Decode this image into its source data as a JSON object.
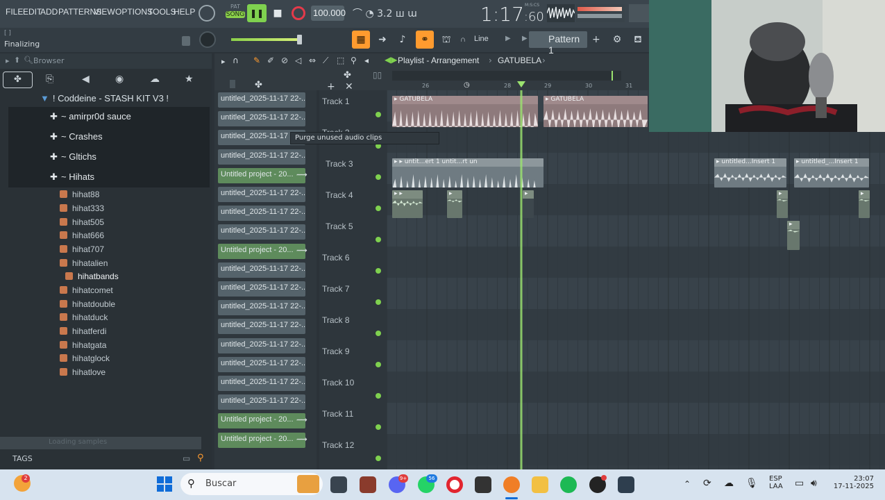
{
  "menu": {
    "items": [
      "FILE",
      "EDIT",
      "ADD",
      "PATTERNS",
      "VIEW",
      "OPTIONS",
      "TOOLS",
      "HELP"
    ]
  },
  "transport": {
    "pat_label": "PAT",
    "song_label": "SONG",
    "tempo": "100.000",
    "time": "1:17",
    "time_sub": ":60",
    "time_unit": "M:S:CS",
    "snap_mode": "Line",
    "pattern": "Pattern 1"
  },
  "hint": {
    "line1": "[ ]",
    "line2": "Finalizing"
  },
  "browser": {
    "title": "Browser",
    "root": "! Coddeine - STASH KIT V3 !",
    "folders": [
      "~ amirpr0d sauce",
      "~ Crashes",
      "~ Gltichs",
      "~ Hihats"
    ],
    "files": [
      "hihat88",
      "hihat333",
      "hihat505",
      "hihat666",
      "hihat707",
      "hihatalien",
      "hihatbands",
      "hihatcomet",
      "hihatdouble",
      "hihatduck",
      "hihatferdi",
      "hihatgata",
      "hihatglock",
      "hihatlove"
    ],
    "status": "Loading samples",
    "tags": "TAGS"
  },
  "playlist": {
    "title": "Playlist - Arrangement",
    "arrangement": "GATUBELA",
    "ruler": [
      "26",
      "28",
      "29",
      "30",
      "31"
    ],
    "tooltip": "Purge unused audio clips"
  },
  "clips": [
    {
      "label": "untitled_2025-11-17 22-...",
      "green": false
    },
    {
      "label": "untitled_2025-11-17 22-...",
      "green": false
    },
    {
      "label": "untitled_2025-11-17 22-...",
      "green": false
    },
    {
      "label": "untitled_2025-11-17 22-...",
      "green": false
    },
    {
      "label": "Untitled project - 20...",
      "green": true
    },
    {
      "label": "untitled_2025-11-17 22-...",
      "green": false
    },
    {
      "label": "untitled_2025-11-17 22-...",
      "green": false
    },
    {
      "label": "untitled_2025-11-17 22-...",
      "green": false
    },
    {
      "label": "Untitled project - 20...",
      "green": true
    },
    {
      "label": "untitled_2025-11-17 22-...",
      "green": false
    },
    {
      "label": "untitled_2025-11-17 22-...",
      "green": false
    },
    {
      "label": "untitled_2025-11-17 22-...",
      "green": false
    },
    {
      "label": "untitled_2025-11-17 22-...",
      "green": false
    },
    {
      "label": "untitled_2025-11-17 22-...",
      "green": false
    },
    {
      "label": "untitled_2025-11-17 22-...",
      "green": false
    },
    {
      "label": "untitled_2025-11-17 22-...",
      "green": false
    },
    {
      "label": "untitled_2025-11-17 22-...",
      "green": false
    },
    {
      "label": "Untitled project - 20...",
      "green": true
    },
    {
      "label": "Untitled project - 20...",
      "green": true
    }
  ],
  "tracks": [
    "Track 1",
    "Track 2",
    "Track 3",
    "Track 4",
    "Track 5",
    "Track 6",
    "Track 7",
    "Track 8",
    "Track 9",
    "Track 10",
    "Track 11",
    "Track 12"
  ],
  "patterns": {
    "t1a": "GATUBELA",
    "t1b": "GATUBELA",
    "t3a": "untit...ert 1",
    "t3b": "untit...rt",
    "t3c": "un",
    "t3d": "untitled...Insert 1",
    "t3e": "untitled_...Insert 1"
  },
  "taskbar": {
    "search": "Buscar",
    "lang1": "ESP",
    "lang2": "LAA",
    "time": "23:07",
    "date": "17-11-2025",
    "weather_badge": "2",
    "discord_badge": "9+",
    "whatsapp_badge": "56"
  },
  "colors": {
    "accent_green": "#7fd14f",
    "accent_orange": "#ff9b2f",
    "playhead": "#9be36f"
  }
}
